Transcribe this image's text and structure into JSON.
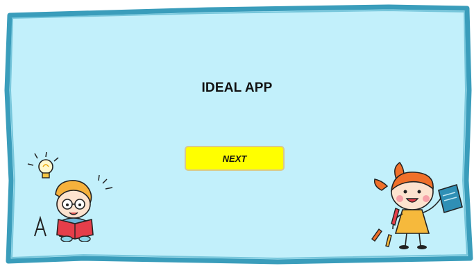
{
  "app": {
    "title": "IDEAL APP",
    "next_label": "NEXT"
  },
  "theme": {
    "background": "#c2f0fb",
    "frame_border": "#3a9dbb",
    "button_fill": "#ffff00",
    "button_border": "#d9c98c"
  },
  "illustrations": {
    "left": "boy-reading-book-with-lightbulb-and-letter-a",
    "right": "girl-holding-notebook-and-pencil"
  },
  "icons": [
    "lightbulb-icon",
    "letter-a-icon",
    "notebook-icon",
    "pencil-icon"
  ]
}
